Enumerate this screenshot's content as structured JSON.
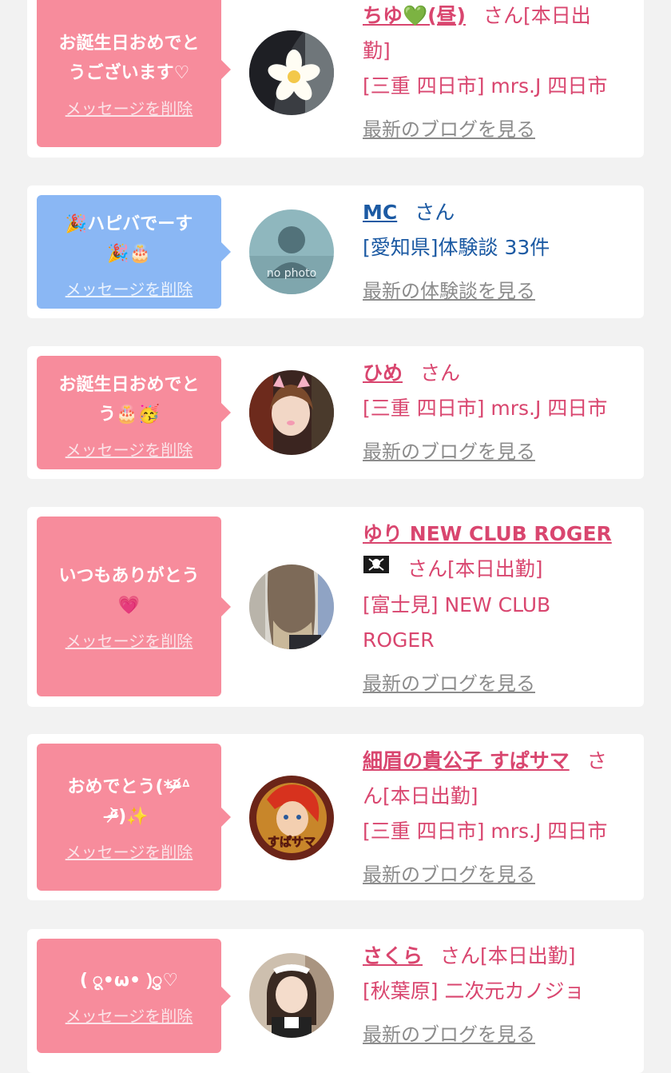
{
  "entries": [
    {
      "message_line1": "お誕生日おめでと",
      "message_line2": "うございます♡",
      "delete_label": "メッセージを削除",
      "name": "ちゆ💚(昼)",
      "san_suffix": "さん[本日出",
      "status_cont": "勤]",
      "location": "[三重 四日市] mrs.J 四日市",
      "link_label": "最新のブログを見る",
      "avatar_icon": "flower-photo"
    },
    {
      "message_line1": "🎉ハピバでーす",
      "message_line2": "🎉🎂",
      "delete_label": "メッセージを削除",
      "name": "MC",
      "san_suffix": "さん",
      "location": "[愛知県]体験談 33件",
      "link_label": "最新の体験談を見る",
      "avatar_icon": "no-photo",
      "no_photo_text": "no photo"
    },
    {
      "message_line1": "お誕生日おめでと",
      "message_line2": "う🎂🥳",
      "delete_label": "メッセージを削除",
      "name": "ひめ",
      "san_suffix": "さん",
      "location": "[三重 四日市] mrs.J 四日市",
      "link_label": "最新のブログを見る",
      "avatar_icon": "girl-photo"
    },
    {
      "message_line1": "いつもありがとう",
      "message_line2": "💗",
      "delete_label": "メッセージを削除",
      "name": "ゆり NEW CLUB ROGER",
      "name_icon": "pirate-flag-icon",
      "san_suffix": "さん[本日出勤]",
      "location_line1": "[富士見] NEW CLUB",
      "location_line2": "ROGER",
      "link_label": "最新のブログを見る",
      "avatar_icon": "hair-photo"
    },
    {
      "message_line1": "おめでとう(*ᵒ̴̶̷᷄ᐞ",
      "message_line2": "ᵒ̴̶̷᷅)✨",
      "delete_label": "メッセージを削除",
      "name": "細眉の貴公子 すぱサマ",
      "san_suffix": "さ",
      "status_cont": "ん[本日出勤]",
      "location": "[三重 四日市] mrs.J 四日市",
      "link_label": "最新のブログを見る",
      "avatar_icon": "anime-photo",
      "avatar_text": "すぱサマ"
    },
    {
      "message_line1": "( ू•ω• )ु♡",
      "delete_label": "メッセージを削除",
      "name": "さくら",
      "san_suffix": "さん[本日出勤]",
      "location": "[秋葉原] 二次元カノジョ",
      "link_label": "最新のブログを見る",
      "avatar_icon": "maid-photo"
    }
  ],
  "colors": {
    "pink_bubble": "#f78c9c",
    "blue_bubble": "#8ab7f4",
    "pink_text": "#d9466f",
    "blue_text": "#1c5aa3",
    "link_gray": "#8c8c8c",
    "background": "#f2f2f2"
  }
}
